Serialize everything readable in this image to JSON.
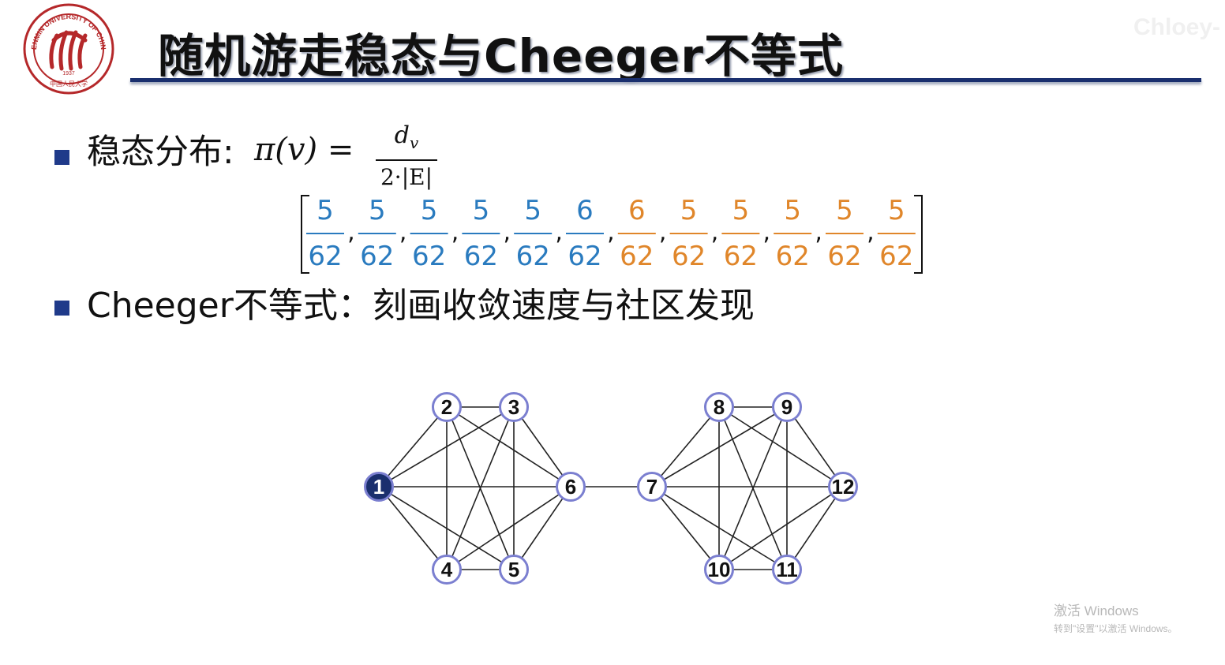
{
  "slide": {
    "title": "随机游走稳态与Cheeger不等式",
    "watermark": "Chloey-",
    "logo_text": "RENMIN UNIVERSITY OF CHINA",
    "logo_year": "1937",
    "logo_chinese": "中国人民大学"
  },
  "bullets": [
    {
      "label": "稳态分布: ",
      "formula": "π(v) = ",
      "frac_num": "d",
      "frac_num_sub": "v",
      "frac_den": "2·|E|"
    },
    {
      "label": "Cheeger不等式：刻画收敛速度与社区发现"
    }
  ],
  "vector": {
    "entries": [
      {
        "num": "5",
        "den": "62",
        "color": "#2a7bbf"
      },
      {
        "num": "5",
        "den": "62",
        "color": "#2a7bbf"
      },
      {
        "num": "5",
        "den": "62",
        "color": "#2a7bbf"
      },
      {
        "num": "5",
        "den": "62",
        "color": "#2a7bbf"
      },
      {
        "num": "5",
        "den": "62",
        "color": "#2a7bbf"
      },
      {
        "num": "6",
        "den": "62",
        "color": "#2a7bbf"
      },
      {
        "num": "6",
        "den": "62",
        "color": "#e0862a"
      },
      {
        "num": "5",
        "den": "62",
        "color": "#e0862a"
      },
      {
        "num": "5",
        "den": "62",
        "color": "#e0862a"
      },
      {
        "num": "5",
        "den": "62",
        "color": "#e0862a"
      },
      {
        "num": "5",
        "den": "62",
        "color": "#e0862a"
      },
      {
        "num": "5",
        "den": "62",
        "color": "#e0862a"
      }
    ],
    "separator": ","
  },
  "graph": {
    "nodes": [
      {
        "id": "1",
        "highlight": true
      },
      {
        "id": "2"
      },
      {
        "id": "3"
      },
      {
        "id": "4"
      },
      {
        "id": "5"
      },
      {
        "id": "6"
      },
      {
        "id": "7"
      },
      {
        "id": "8"
      },
      {
        "id": "9"
      },
      {
        "id": "10"
      },
      {
        "id": "11"
      },
      {
        "id": "12"
      }
    ],
    "edges": [
      [
        "1",
        "2"
      ],
      [
        "1",
        "3"
      ],
      [
        "1",
        "4"
      ],
      [
        "1",
        "5"
      ],
      [
        "1",
        "6"
      ],
      [
        "2",
        "3"
      ],
      [
        "2",
        "4"
      ],
      [
        "2",
        "5"
      ],
      [
        "2",
        "6"
      ],
      [
        "3",
        "4"
      ],
      [
        "3",
        "5"
      ],
      [
        "3",
        "6"
      ],
      [
        "4",
        "5"
      ],
      [
        "4",
        "6"
      ],
      [
        "5",
        "6"
      ],
      [
        "6",
        "7"
      ],
      [
        "7",
        "8"
      ],
      [
        "7",
        "9"
      ],
      [
        "7",
        "10"
      ],
      [
        "7",
        "11"
      ],
      [
        "7",
        "12"
      ],
      [
        "8",
        "9"
      ],
      [
        "8",
        "10"
      ],
      [
        "8",
        "11"
      ],
      [
        "8",
        "12"
      ],
      [
        "9",
        "10"
      ],
      [
        "9",
        "11"
      ],
      [
        "9",
        "12"
      ],
      [
        "10",
        "11"
      ],
      [
        "10",
        "12"
      ],
      [
        "11",
        "12"
      ]
    ],
    "colors": {
      "node_fill": "#ffffff",
      "node_stroke": "#7b7fd0",
      "highlight_fill": "#1a2f6e",
      "edge": "#222222"
    }
  },
  "os_overlay": {
    "activate_title": "激活 Windows",
    "activate_hint": "转到\"设置\"以激活 Windows。"
  }
}
